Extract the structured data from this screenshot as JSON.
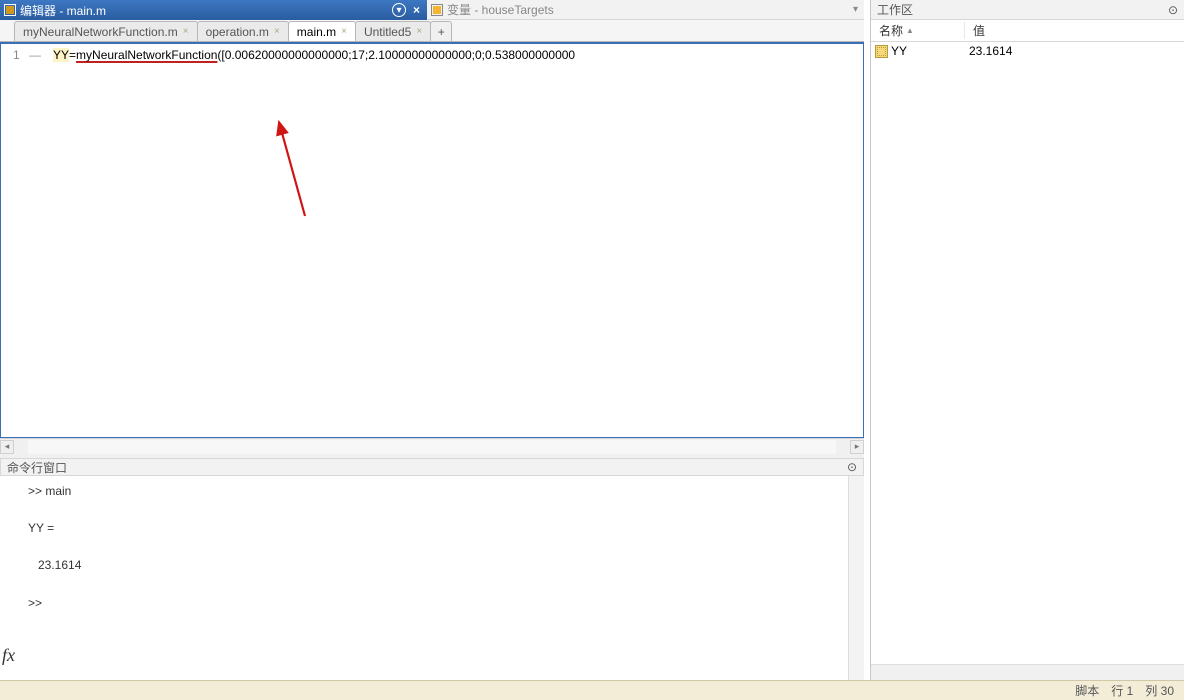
{
  "editor": {
    "titlebar": "编辑器 - main.m",
    "tabs": [
      {
        "label": "myNeuralNetworkFunction.m",
        "active": false,
        "closable": true
      },
      {
        "label": "operation.m",
        "active": false,
        "closable": true
      },
      {
        "label": "main.m",
        "active": true,
        "closable": true
      },
      {
        "label": "Untitled5",
        "active": false,
        "closable": true
      }
    ],
    "line_number": "1",
    "code_var": "YY",
    "code_eq": "=",
    "code_fn": "myNeuralNetworkFunction",
    "code_args": "([0.00620000000000000;17;2.10000000000000;0;0.538000000000"
  },
  "variables_panel": {
    "title": "变量 - houseTargets"
  },
  "command_window": {
    "title": "命令行窗口",
    "content": ">> main\n\nYY =\n\n   23.1614\n\n>> "
  },
  "workspace": {
    "title": "工作区",
    "columns": {
      "name": "名称",
      "value": "值"
    },
    "rows": [
      {
        "name": "YY",
        "value": "23.1614"
      }
    ]
  },
  "statusbar": {
    "mode": "脚本",
    "line_label": "行",
    "line": "1",
    "col_label": "列",
    "col": "30"
  }
}
